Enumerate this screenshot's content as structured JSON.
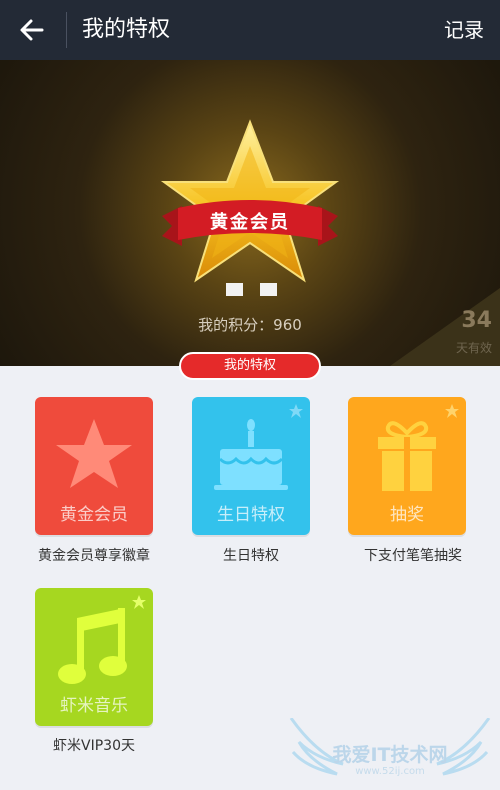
{
  "header": {
    "title": "我的特权",
    "record_label": "记录"
  },
  "hero": {
    "badge_text": "黄金会员",
    "points_label": "我的积分：960",
    "days_number": "34",
    "days_label": "天有效"
  },
  "section_pill": "我的特权",
  "tiles": [
    {
      "label": "黄金会员",
      "caption": "黄金会员尊享徽章",
      "color": "#ef4b3c"
    },
    {
      "label": "生日特权",
      "caption": "生日特权",
      "color": "#33c2ec"
    },
    {
      "label": "抽奖",
      "caption": "下支付笔笔抽奖",
      "color": "#ffa71d"
    },
    {
      "label": "虾米音乐",
      "caption": "虾米VIP30天",
      "color": "#a6d720"
    }
  ],
  "watermark": {
    "main": "我爱IT技术网",
    "sub": "www.52ij.com"
  }
}
